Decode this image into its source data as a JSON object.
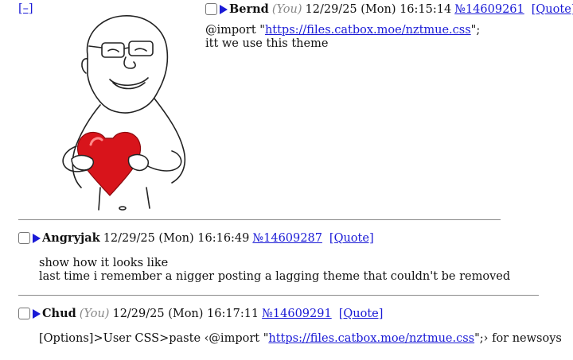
{
  "op": {
    "collapse_label": "[–]",
    "name": "Bernd",
    "you": "(You)",
    "datetime": "12/29/25 (Mon) 16:15:14",
    "post_no": "№14609261",
    "quote_label": "[Quote]",
    "line1_prefix": "@import \"",
    "line1_link": "https://files.catbox.moe/nztmue.css",
    "line1_suffix": "\";",
    "line2": "itt we use this theme",
    "image_icon": "wojak-heart-image"
  },
  "replies": [
    {
      "name": "Angryjak",
      "datetime": "12/29/25 (Mon) 16:16:49",
      "post_no": "№14609287",
      "quote_label": "[Quote]",
      "line1": "show how it looks like",
      "line2": "last time i remember a nigger posting a lagging theme that couldn't be removed"
    },
    {
      "name": "Chud",
      "you": "(You)",
      "datetime": "12/29/25 (Mon) 16:17:11",
      "post_no": "№14609291",
      "quote_label": "[Quote]",
      "line1_prefix": "[Options]>User CSS>paste ‹@import \"",
      "line1_link": "https://files.catbox.moe/nztmue.css",
      "line1_suffix": "\";› for newsoys"
    }
  ],
  "colors": {
    "link": "#1a1ad6",
    "you": "#888888",
    "heart": "#d8141b"
  }
}
